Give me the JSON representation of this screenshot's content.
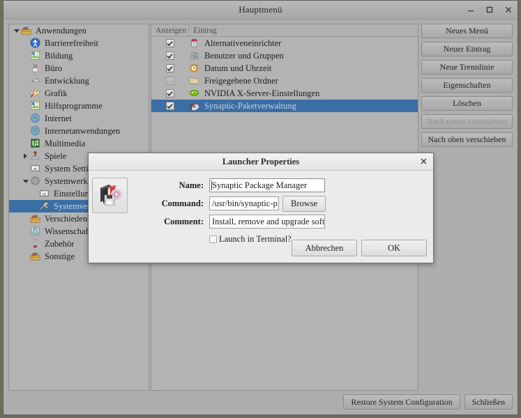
{
  "window": {
    "title": "Hauptmenü",
    "controls": [
      {
        "name": "minimize",
        "glyph": "minimize-icon"
      },
      {
        "name": "maximize",
        "glyph": "maximize-icon"
      },
      {
        "name": "close",
        "glyph": "close-icon"
      }
    ]
  },
  "tree": {
    "items": [
      {
        "label": "Anwendungen",
        "depth": 0,
        "twisty": "down",
        "icon": "toolbox-icon",
        "selected": false
      },
      {
        "label": "Barrierefreiheit",
        "depth": 1,
        "twisty": "none",
        "icon": "accessibility-icon",
        "selected": false
      },
      {
        "label": "Bildung",
        "depth": 1,
        "twisty": "none",
        "icon": "education-icon",
        "selected": false
      },
      {
        "label": "Büro",
        "depth": 1,
        "twisty": "none",
        "icon": "office-icon",
        "selected": false
      },
      {
        "label": "Entwicklung",
        "depth": 1,
        "twisty": "none",
        "icon": "development-icon",
        "selected": false
      },
      {
        "label": "Grafik",
        "depth": 1,
        "twisty": "none",
        "icon": "graphics-icon",
        "selected": false
      },
      {
        "label": "Hilfsprogramme",
        "depth": 1,
        "twisty": "none",
        "icon": "education-icon",
        "selected": false
      },
      {
        "label": "Internet",
        "depth": 1,
        "twisty": "none",
        "icon": "globe-icon",
        "selected": false
      },
      {
        "label": "Internetanwendungen",
        "depth": 1,
        "twisty": "none",
        "icon": "globe-icon",
        "selected": false
      },
      {
        "label": "Multimedia",
        "depth": 1,
        "twisty": "none",
        "icon": "multimedia-icon",
        "selected": false
      },
      {
        "label": "Spiele",
        "depth": 1,
        "twisty": "right",
        "icon": "games-icon",
        "selected": false
      },
      {
        "label": "System Settings",
        "depth": 1,
        "twisty": "none",
        "icon": "settings-icon",
        "selected": false
      },
      {
        "label": "Systemwerkzeuge",
        "depth": 1,
        "twisty": "down",
        "icon": "gear-icon",
        "selected": false
      },
      {
        "label": "Einstellungen",
        "depth": 2,
        "twisty": "none",
        "icon": "settings-icon",
        "selected": false
      },
      {
        "label": "Systemverwaltung",
        "depth": 2,
        "twisty": "none",
        "icon": "tools-icon",
        "selected": true
      },
      {
        "label": "Verschiedenes",
        "depth": 1,
        "twisty": "none",
        "icon": "toolbox-icon",
        "selected": false
      },
      {
        "label": "Wissenschaft",
        "depth": 1,
        "twisty": "none",
        "icon": "science-icon",
        "selected": false
      },
      {
        "label": "Zubehör",
        "depth": 1,
        "twisty": "none",
        "icon": "accessories-icon",
        "selected": false
      },
      {
        "label": "Sonstige",
        "depth": 1,
        "twisty": "none",
        "icon": "toolbox-icon",
        "selected": false
      }
    ]
  },
  "list": {
    "headers": {
      "show": "Anzeigen",
      "entry": "Eintrag"
    },
    "rows": [
      {
        "checked": true,
        "icon": "alternatives-icon",
        "label": "Alternativeneinrichter",
        "selected": false
      },
      {
        "checked": true,
        "icon": "users-icon",
        "label": "Benutzer und Gruppen",
        "selected": false
      },
      {
        "checked": true,
        "icon": "clock-icon",
        "label": "Datum und Uhrzeit",
        "selected": false
      },
      {
        "checked": false,
        "icon": "folder-icon",
        "label": "Freigegebene Ordner",
        "selected": false
      },
      {
        "checked": true,
        "icon": "nvidia-icon",
        "label": "NVIDIA X-Server-Einstellungen",
        "selected": false
      },
      {
        "checked": true,
        "icon": "synaptic-icon",
        "label": "Synaptic-Paketverwaltung",
        "selected": true
      }
    ]
  },
  "side_buttons": [
    {
      "label": "Neues Menü",
      "disabled": false
    },
    {
      "label": "Neuer Eintrag",
      "disabled": false
    },
    {
      "label": "Neue Trennlinie",
      "disabled": false
    },
    {
      "label": "Eigenschaften",
      "disabled": false
    },
    {
      "label": "Löschen",
      "disabled": false
    },
    {
      "label": "Nach unten verschieben",
      "disabled": true
    },
    {
      "label": "Nach oben verschieben",
      "disabled": false
    }
  ],
  "bottom_buttons": [
    {
      "label": "Restore System Configuration"
    },
    {
      "label": "Schließen"
    }
  ],
  "dialog": {
    "title": "Launcher Properties",
    "icon": "synaptic-large-icon",
    "fields": {
      "name_label": "Name:",
      "name_value": "Synaptic Package Manager",
      "command_label": "Command:",
      "command_value": "/usr/bin/synaptic-p",
      "browse_label": "Browse",
      "comment_label": "Comment:",
      "comment_value": "Install, remove and upgrade soft"
    },
    "terminal": {
      "label": "Launch in Terminal?",
      "checked": false
    },
    "actions": [
      {
        "label": "Abbrechen"
      },
      {
        "label": "OK"
      }
    ]
  },
  "colors": {
    "selection_blue": "#3b6ea5",
    "window_bg": "#aeaeae",
    "pane_bg": "#b3b3b3",
    "dialog_bg": "#ebebeb"
  }
}
